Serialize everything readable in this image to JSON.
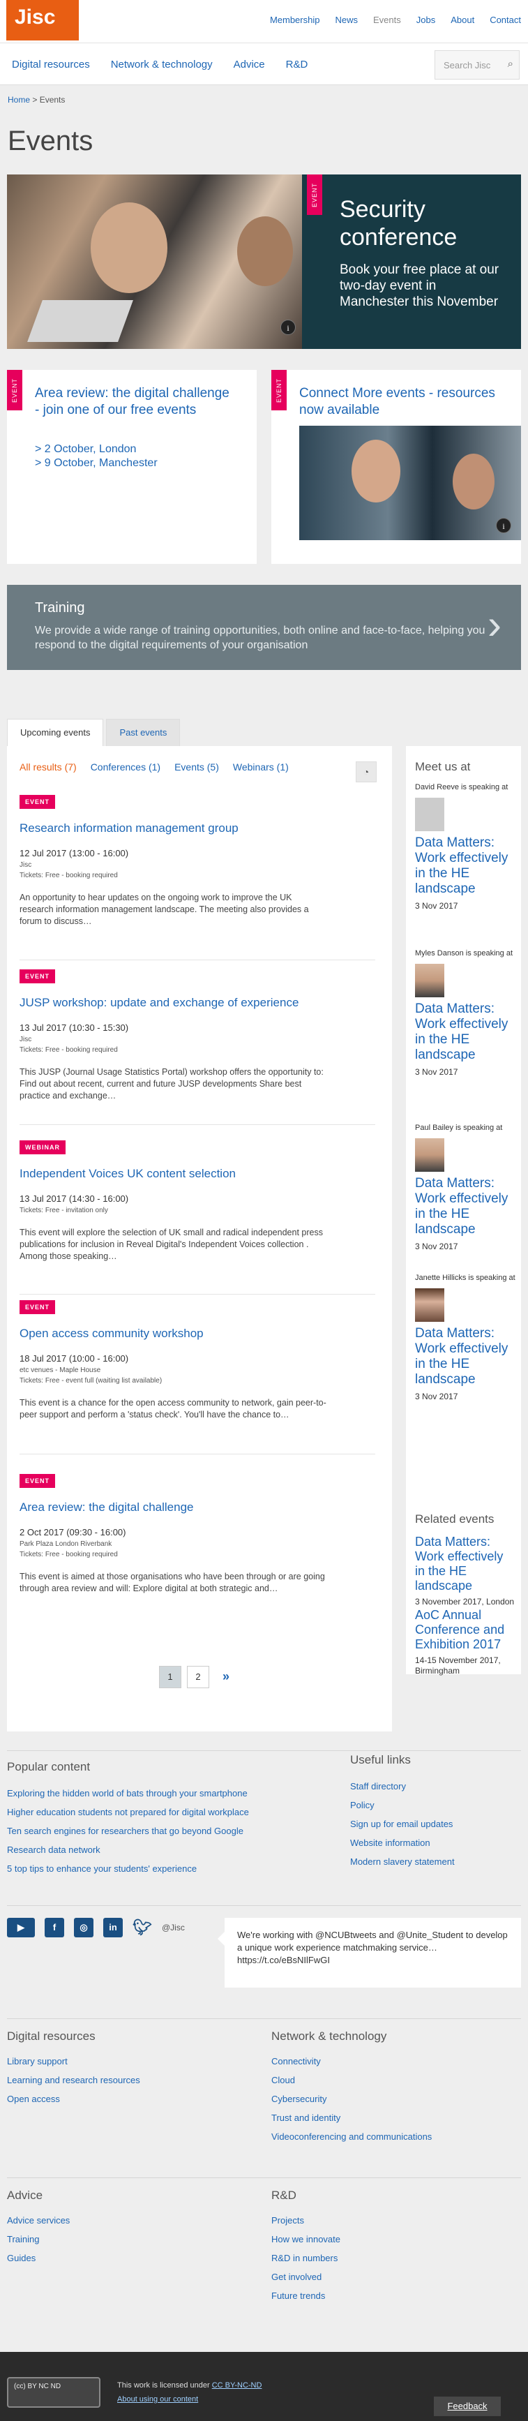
{
  "header": {
    "logo": "Jisc",
    "top_links": [
      "Membership",
      "News",
      "Events",
      "Jobs",
      "About",
      "Contact"
    ],
    "main_nav": [
      "Digital resources",
      "Network & technology",
      "Advice",
      "R&D"
    ],
    "search_placeholder": "Search Jisc"
  },
  "breadcrumb": {
    "home": "Home",
    "sep": " > ",
    "current": "Events"
  },
  "page_title": "Events",
  "hero": {
    "tag": "EVENT",
    "title": "Security conference",
    "text": "Book your free place at our two-day event in Manchester this November",
    "info": "i"
  },
  "cards": [
    {
      "tag": "EVENT",
      "title": "Area review: the digital challenge - join one of our free events",
      "lines": [
        "> 2 October, London",
        "> 9 October, Manchester"
      ]
    },
    {
      "tag": "EVENT",
      "title": "Connect More events - resources now available",
      "info": "i"
    }
  ],
  "training": {
    "title": "Training",
    "text": "We provide a wide range of training opportunities, both online and face-to-face, helping you respond to the digital requirements of your organisation",
    "arrow": "›"
  },
  "tabs": [
    "Upcoming events",
    "Past events"
  ],
  "filters": [
    "All results  (7)",
    "Conferences  (1)",
    "Events  (5)",
    "Webinars  (1)"
  ],
  "rss_icon": "RSS",
  "events": [
    {
      "tag": "EVENT",
      "title": "Research information management group",
      "date": "12 Jul 2017 (13:00 - 16:00)",
      "venue": "Jisc",
      "tickets": "Tickets: Free - booking required",
      "desc": "An opportunity to hear updates on the ongoing work to improve the UK research information management landscape. The meeting also provides a forum to discuss…"
    },
    {
      "tag": "EVENT",
      "title": "JUSP workshop: update and exchange of experience",
      "date": "13 Jul 2017 (10:30 - 15:30)",
      "venue": "Jisc",
      "tickets": "Tickets: Free - booking required",
      "desc": "This JUSP (Journal Usage Statistics Portal) workshop offers the opportunity to: Find out about recent, current and future JUSP developments Share best practice and exchange…"
    },
    {
      "tag": "WEBINAR",
      "title": "Independent Voices UK content selection",
      "date": "13 Jul 2017 (14:30 - 16:00)",
      "venue": "Tickets: Free - invitation only",
      "tickets": "",
      "desc": "This event will explore the selection of UK small and radical independent press publications for inclusion in Reveal Digital's Independent Voices collection . Among those speaking…"
    },
    {
      "tag": "EVENT",
      "title": "Open access community workshop",
      "date": "18 Jul 2017 (10:00 - 16:00)",
      "venue": "etc venues - Maple House",
      "tickets": "Tickets: Free - event full (waiting list available)",
      "desc": "This event is a chance for the open access community to network, gain peer-to-peer support and perform a 'status check'. You'll have the chance to…"
    },
    {
      "tag": "EVENT",
      "title": "Area review: the digital challenge",
      "date": "2 Oct 2017 (09:30 - 16:00)",
      "venue": "Park Plaza London Riverbank",
      "tickets": "Tickets: Free - booking required",
      "desc": "This event is aimed at those organisations who have been through or are going through area review and will: Explore digital at both strategic and…"
    }
  ],
  "pager": [
    "1",
    "2",
    "»"
  ],
  "meet_us": {
    "heading": "Meet us at",
    "speakers": [
      {
        "text": "David Reeve is speaking at",
        "event": "Data Matters: Work effectively in the HE landscape",
        "date": "3 Nov 2017"
      },
      {
        "text": "Myles Danson is speaking at",
        "event": "Data Matters: Work effectively in the HE landscape",
        "date": "3 Nov 2017"
      },
      {
        "text": "Paul Bailey is speaking at",
        "event": "Data Matters: Work effectively in the HE landscape",
        "date": "3 Nov 2017"
      },
      {
        "text": "Janette Hillicks is speaking at",
        "event": "Data Matters: Work effectively in the HE landscape",
        "date": "3 Nov 2017"
      }
    ]
  },
  "related": {
    "heading": "Related events",
    "items": [
      {
        "title": "Data Matters: Work effectively in the HE landscape",
        "date": "3 November 2017, London"
      },
      {
        "title": "AoC Annual Conference and Exhibition 2017",
        "date": "14-15 November 2017, Birmingham"
      }
    ]
  },
  "popular": {
    "heading": "Popular content",
    "items": [
      "Exploring the hidden world of bats through your smartphone",
      "Higher education students not prepared for digital workplace",
      "Ten search engines for researchers that go beyond Google",
      "Research data network",
      "5 top tips to enhance your students' experience"
    ]
  },
  "useful": {
    "heading": "Useful links",
    "items": [
      "Staff directory",
      "Policy",
      "Sign up for email updates",
      "Website information",
      "Modern slavery statement"
    ]
  },
  "social": {
    "handle": "@Jisc",
    "icons": [
      "YouTube",
      "f",
      "ig",
      "in",
      "tw"
    ]
  },
  "tweet": {
    "text": "We're working with @NCUBtweets and @Unite_Student to develop a unique work experience matchmaking service… https://t.co/eBsNIlFwGI"
  },
  "footer_sections": [
    {
      "heading": "Digital resources",
      "items": [
        "Library support",
        "Learning and research resources",
        "Open access"
      ]
    },
    {
      "heading": "Network & technology",
      "items": [
        "Connectivity",
        "Cloud",
        "Cybersecurity",
        "Trust and identity",
        "Videoconferencing and communications"
      ]
    },
    {
      "heading": "Advice",
      "items": [
        "Advice services",
        "Training",
        "Guides"
      ]
    },
    {
      "heading": "R&D",
      "items": [
        "Projects",
        "How we innovate",
        "R&D in numbers",
        "Get involved",
        "Future trends"
      ]
    }
  ],
  "footer": {
    "cc_badge": "(cc) BY NC ND",
    "license_text": "This work is licensed under ",
    "license_link": "CC BY-NC-ND",
    "reuse": "About using our content",
    "feedback": "Feedback"
  }
}
